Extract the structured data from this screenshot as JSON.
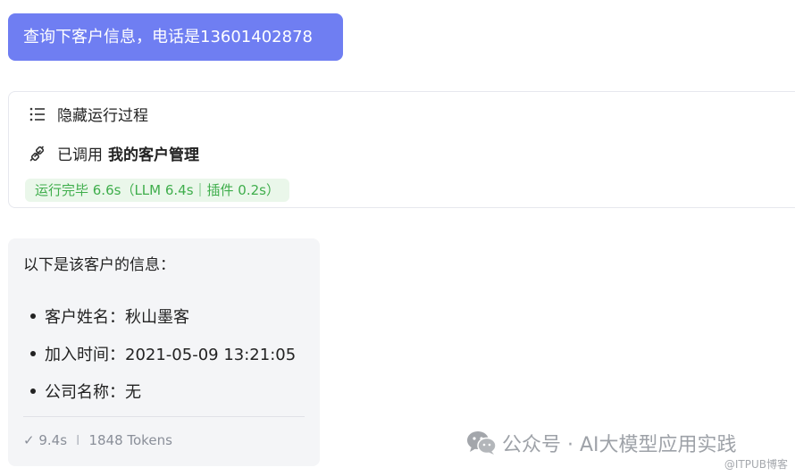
{
  "user_message": "查询下客户信息，电话是13601402878",
  "process": {
    "toggle_label": "隐藏运行过程",
    "called_prefix": "已调用",
    "called_plugin": "我的客户管理",
    "status": "运行完毕 6.6s（LLM 6.4s｜插件 0.2s）",
    "icons": {
      "toggle": "list-icon",
      "plugin": "plug-icon"
    }
  },
  "answer": {
    "intro": "以下是该客户的信息：",
    "items": [
      "客户姓名：秋山墨客",
      "加入时间：2021-05-09 13:21:05",
      "公司名称：无"
    ],
    "meta_time": "✓ 9.4s",
    "meta_sep": "I",
    "meta_tokens": "1848 Tokens"
  },
  "watermark": {
    "text": "公众号 · AI大模型应用实践",
    "sub": "@ITPUB博客",
    "icon": "wechat-icon"
  },
  "colors": {
    "user_bubble": "#6f7ef2",
    "status_green": "#3fae4c",
    "status_bg": "#eaf7ea",
    "answer_bg": "#f4f5f7"
  }
}
